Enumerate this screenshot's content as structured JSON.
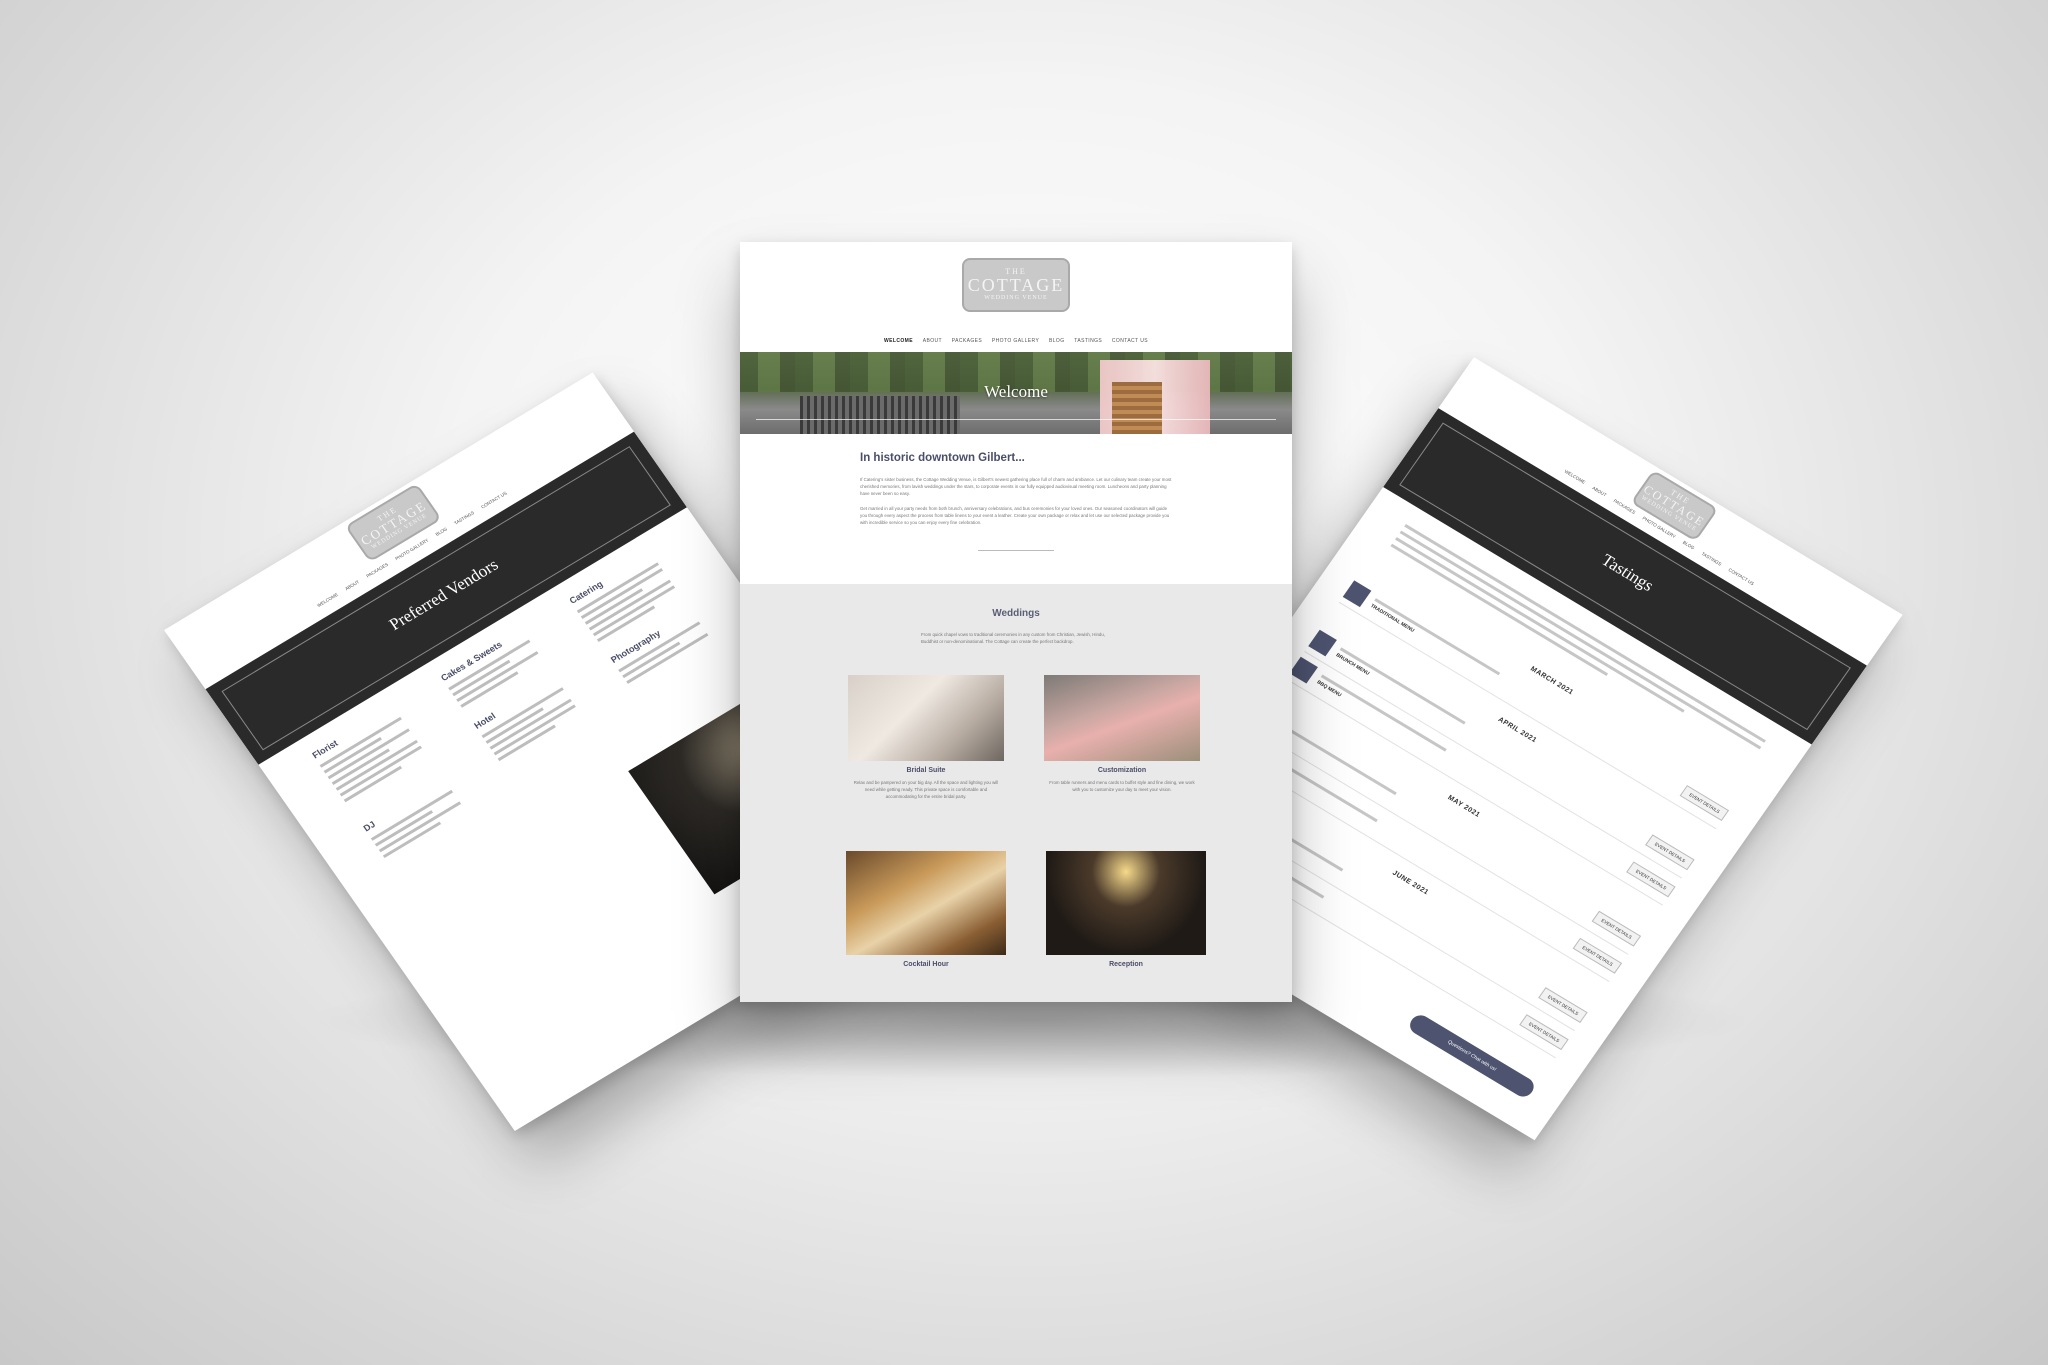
{
  "center": {
    "logo": {
      "line1": "THE",
      "line2": "COTTAGE",
      "line3": "WEDDING VENUE"
    },
    "nav": [
      "WELCOME",
      "ABOUT",
      "PACKAGES",
      "PHOTO GALLERY",
      "BLOG",
      "TASTINGS",
      "CONTACT US"
    ],
    "hero_title": "Welcome",
    "intro_title": "In historic downtown Gilbert...",
    "intro_p1": "If Catering's sister business, the Cottage Wedding Venue, is Gilbert's newest gathering place full of charm and ambiance. Let our culinary team create your most cherished memories, from lavish weddings under the stars, to corporate events in our fully equipped audiovisual meeting room. Luncheons and party planning have never been so easy.",
    "intro_p2": "Get married in all your party needs from both brunch, anniversary celebrations, and bus ceremonies for your loved ones. Our seasoned coordinators will guide you through every aspect the process from table linens to your event a leather. Create your own package or relax and let use our selected package provide you with incredible service so you can enjoy every fine celebration.",
    "weddings_title": "Weddings",
    "weddings_desc": "From quick chapel vows to traditional ceremonies in any custom from Christian, Jewish, Hindu, Buddhist or non-denominational. The Cottage can create the perfect backdrop.",
    "cards": [
      {
        "title": "Bridal Suite",
        "desc": "Relax and be pampered on your big day. All the space and lighting you will need while getting ready. This private space is comfortable and accommodating for the entire bridal party."
      },
      {
        "title": "Customization",
        "desc": "From table runners and menu cards to buffet style and fine dining, we work with you to customize your day to meet your vision."
      },
      {
        "title": "Cocktail Hour",
        "desc": ""
      },
      {
        "title": "Reception",
        "desc": ""
      }
    ]
  },
  "left": {
    "logo": {
      "line1": "THE",
      "line2": "COTTAGE",
      "line3": "WEDDING VENUE"
    },
    "nav": [
      "WELCOME",
      "ABOUT",
      "PACKAGES",
      "PHOTO GALLERY",
      "BLOG",
      "TASTINGS",
      "CONTACT US"
    ],
    "band_title": "Preferred Vendors",
    "columns": [
      {
        "heading": "Florist",
        "sub": "DJ"
      },
      {
        "heading": "Cakes & Sweets",
        "sub": "Hotel"
      },
      {
        "heading": "Catering",
        "sub": "Photography"
      }
    ]
  },
  "right": {
    "logo": {
      "line1": "THE",
      "line2": "COTTAGE",
      "line3": "WEDDING VENUE"
    },
    "nav": [
      "WELCOME",
      "ABOUT",
      "PACKAGES",
      "PHOTO GALLERY",
      "BLOG",
      "TASTINGS",
      "CONTACT US"
    ],
    "band_title": "Tastings",
    "months": [
      {
        "name": "MARCH 2021",
        "events": [
          {
            "title": "TRADITIONAL MENU",
            "button": "EVENT DETAILS"
          }
        ]
      },
      {
        "name": "APRIL 2021",
        "events": [
          {
            "title": "BRUNCH MENU",
            "button": "EVENT DETAILS"
          },
          {
            "title": "BBQ MENU",
            "button": "EVENT DETAILS"
          }
        ]
      },
      {
        "name": "MAY 2021",
        "events": [
          {
            "title": "",
            "button": "EVENT DETAILS"
          },
          {
            "title": "",
            "button": "EVENT DETAILS"
          }
        ]
      },
      {
        "name": "JUNE 2021",
        "events": [
          {
            "title": "",
            "button": "EVENT DETAILS"
          },
          {
            "title": "",
            "button": "EVENT DETAILS"
          }
        ]
      }
    ],
    "chat_label": "Questions? Chat with us!"
  },
  "colors": {
    "accent": "#4a4e68",
    "band": "#2a2a2a",
    "pill": "#4e5470"
  }
}
